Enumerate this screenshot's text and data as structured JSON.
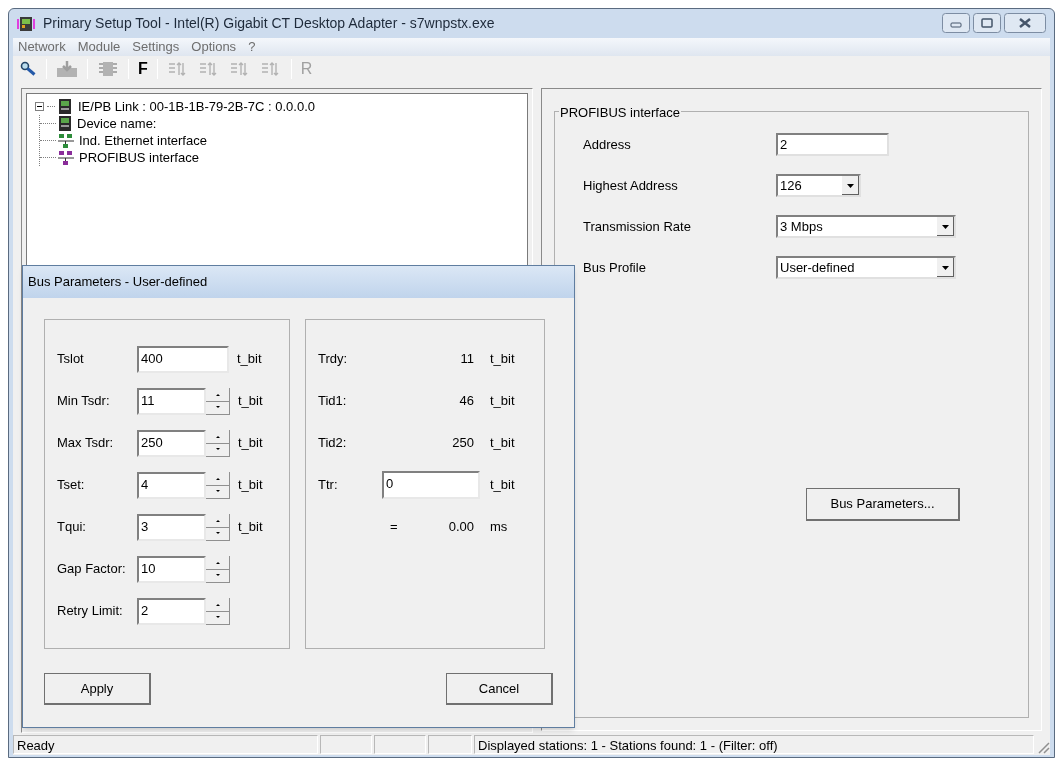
{
  "window": {
    "title": "Primary Setup Tool - Intel(R) Gigabit CT Desktop Adapter - s7wnpstx.exe"
  },
  "menu": [
    "Network",
    "Module",
    "Settings",
    "Options",
    "?"
  ],
  "toolbar": [
    {
      "kind": "tool",
      "disabled": false
    },
    {
      "kind": "separator"
    },
    {
      "kind": "tool",
      "disabled": true
    },
    {
      "kind": "separator"
    },
    {
      "kind": "tool",
      "disabled": true
    },
    {
      "kind": "separator"
    },
    {
      "kind": "letter",
      "label": "F",
      "disabled": false
    },
    {
      "kind": "separator"
    },
    {
      "kind": "tool",
      "disabled": true
    },
    {
      "kind": "tool",
      "disabled": true
    },
    {
      "kind": "tool",
      "disabled": true
    },
    {
      "kind": "tool",
      "disabled": true
    },
    {
      "kind": "separator"
    },
    {
      "kind": "letter",
      "label": "R",
      "disabled": true
    }
  ],
  "tree": {
    "label": "IE/PB Link : 00-1B-1B-79-2B-7C : 0.0.0.0",
    "expanded": true,
    "children": [
      {
        "label": "Device name:"
      },
      {
        "label": "Ind. Ethernet interface"
      },
      {
        "label": "PROFIBUS interface"
      }
    ]
  },
  "profibus": {
    "title": "PROFIBUS interface",
    "fields": [
      {
        "kind": "input",
        "label": "Address",
        "value": "2"
      },
      {
        "kind": "combo",
        "label": "Highest Address",
        "value": "126"
      },
      {
        "kind": "wide-combo",
        "label": "Transmission Rate",
        "value": "3 Mbps"
      },
      {
        "kind": "wide-combo",
        "label": "Bus Profile",
        "value": "User-defined"
      }
    ],
    "button": "Bus Parameters..."
  },
  "dialog": {
    "title": "Bus Parameters - User-defined",
    "params": [
      {
        "kind": "input",
        "label": "Tslot",
        "value": "400",
        "unit": "t_bit"
      },
      {
        "kind": "spin",
        "label": "Min Tsdr:",
        "value": "11",
        "unit": "t_bit"
      },
      {
        "kind": "spin",
        "label": "Max Tsdr:",
        "value": "250",
        "unit": "t_bit"
      },
      {
        "kind": "spin",
        "label": "Tset:",
        "value": "4",
        "unit": "t_bit"
      },
      {
        "kind": "spin",
        "label": "Tqui:",
        "value": "3",
        "unit": "t_bit"
      },
      {
        "kind": "spin",
        "label": "Gap Factor:",
        "value": "10"
      },
      {
        "kind": "spin",
        "label": "Retry Limit:",
        "value": "2"
      }
    ],
    "timing": [
      {
        "kind": "readout",
        "label": "Trdy:",
        "value": "11",
        "unit": "t_bit"
      },
      {
        "kind": "readout",
        "label": "Tid1:",
        "value": "46",
        "unit": "t_bit"
      },
      {
        "kind": "readout",
        "label": "Tid2:",
        "value": "250",
        "unit": "t_bit"
      },
      {
        "kind": "input",
        "label": "Ttr:",
        "value": "0",
        "unit": "t_bit"
      },
      {
        "kind": "result",
        "label": "=",
        "value": "0.00",
        "unit": "ms"
      }
    ],
    "buttons": [
      "Apply",
      "Cancel"
    ]
  },
  "status_bar": {
    "message": "Ready",
    "info": "Displayed stations: 1 - Stations found: 1 - (Filter: off)"
  }
}
